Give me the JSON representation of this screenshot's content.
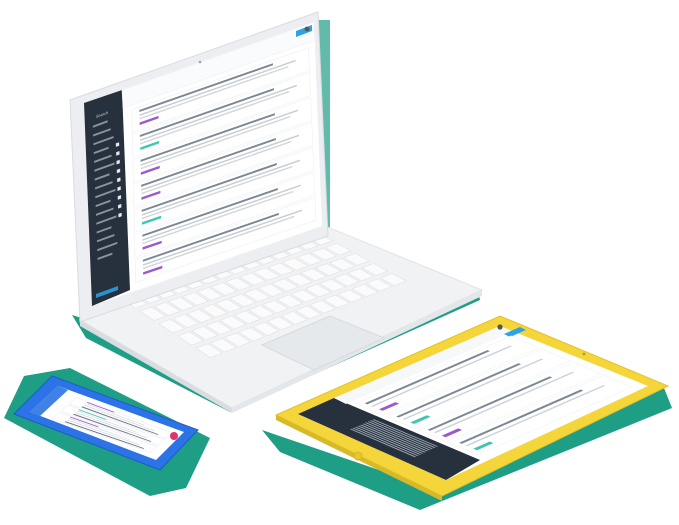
{
  "colors": {
    "background": "#ffffff",
    "shadow_green": "#1f9e86",
    "device_silver": "#eef0f2",
    "sidebar_dark": "#26313d",
    "accent_blue": "#2aa4e4",
    "accent_purple": "#9b59d0",
    "accent_teal": "#3ec7b0",
    "accent_pink": "#e2336b",
    "tablet_yellow": "#f4d53a",
    "phone_blue": "#2b73e6"
  },
  "devices": {
    "laptop": {
      "icon": "laptop-icon",
      "screen_rows": 7,
      "keyboard_rows": 5
    },
    "tablet": {
      "icon": "tablet-icon",
      "screen_rows": 4
    },
    "phone": {
      "icon": "phone-icon",
      "screen_rows": 3
    }
  },
  "illustration": {
    "laptop_sidebar_heading": "Search"
  }
}
